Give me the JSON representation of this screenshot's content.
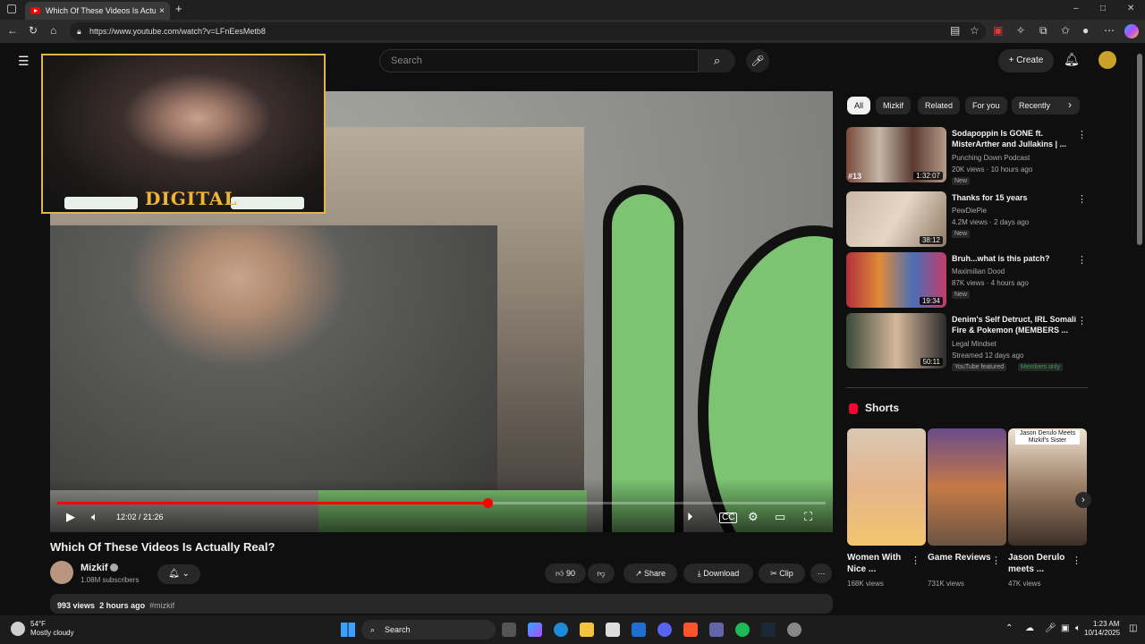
{
  "browser": {
    "tab_title": "Which Of These Videos Is Actuall",
    "url": "https://www.youtube.com/watch?v=LFnEesMetb8"
  },
  "header": {
    "search_placeholder": "Search",
    "create_label": "Create"
  },
  "player": {
    "time": "12:02 / 21:26",
    "progress": 0.56,
    "overlay_logo": "DIGITAL"
  },
  "video": {
    "title": "Which Of These Videos Is Actually Real?",
    "channel": "Mizkif",
    "subscribers": "1.08M subscribers",
    "likes": "90",
    "share_label": "Share",
    "download_label": "Download",
    "clip_label": "Clip",
    "views": "993 views",
    "posted": "2 hours ago",
    "hashtag": "#mizkif"
  },
  "sidebar": {
    "chips": [
      "All",
      "Mizkif",
      "Related",
      "For you",
      "Recently"
    ],
    "recommendations": [
      {
        "title": "Sodapoppin Is GONE ft. MisterArther and Jullakins | ...",
        "channel": "Punching Down Podcast",
        "meta": "20K views · 10 hours ago",
        "badge": "New",
        "duration": "1:32:07",
        "rank": "#13"
      },
      {
        "title": "Thanks for 15 years",
        "channel": "PewDiePie",
        "meta": "4.2M views · 2 days ago",
        "badge": "New",
        "duration": "38:12"
      },
      {
        "title": "Bruh...what is this patch?",
        "channel": "Maximilian Dood",
        "meta": "87K views · 4 hours ago",
        "badge": "New",
        "duration": "19:34"
      },
      {
        "title": "Denim's Self Detruct, IRL Somali Fire & Pokemon (MEMBERS ...",
        "channel": "Legal Mindset",
        "meta": "Streamed 12 days ago",
        "badge": "YouTube featured",
        "badge2": "Members only",
        "duration": "50:11"
      }
    ],
    "shorts_header": "Shorts",
    "shorts": [
      {
        "title": "Women With Nice ...",
        "views": "168K views"
      },
      {
        "title": "Game Reviews",
        "views": "731K views"
      },
      {
        "title": "Jason Derulo meets ...",
        "views": "47K views",
        "overlay": "Jason Derulo Meets Mizkif's Sister"
      }
    ]
  },
  "taskbar": {
    "temp": "54°F",
    "weather": "Mostly cloudy",
    "search": "Search",
    "time": "1:23 AM",
    "date": "10/14/2025"
  },
  "colors": {
    "accent": "#ff0000",
    "bg": "#0f0f0f",
    "chip_bg": "#272727"
  }
}
